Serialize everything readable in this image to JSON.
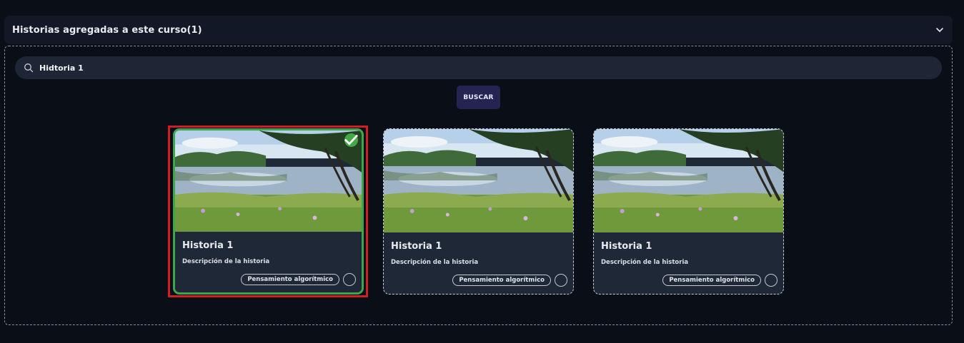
{
  "accordion": {
    "title": "Historias agregadas a este curso(1)",
    "icon": "chevron-down-icon"
  },
  "search": {
    "value": "Hidtoria 1",
    "placeholder": "",
    "button_label": "BUSCAR",
    "icon": "search-icon"
  },
  "cards": [
    {
      "title": "Historia 1",
      "description": "Descripción de la historia",
      "tag": "Pensamiento algorítmico",
      "selected": true
    },
    {
      "title": "Historia 1",
      "description": "Descripción de la historia",
      "tag": "Pensamiento algorítmico",
      "selected": false
    },
    {
      "title": "Historia 1",
      "description": "Descripción de la historia",
      "tag": "Pensamiento algorítmico",
      "selected": false
    }
  ],
  "colors": {
    "background": "#0a0e17",
    "card_background": "#1e2837",
    "selected_border": "#3ea64c",
    "highlight": "#d01f24",
    "button_background": "#242453"
  }
}
